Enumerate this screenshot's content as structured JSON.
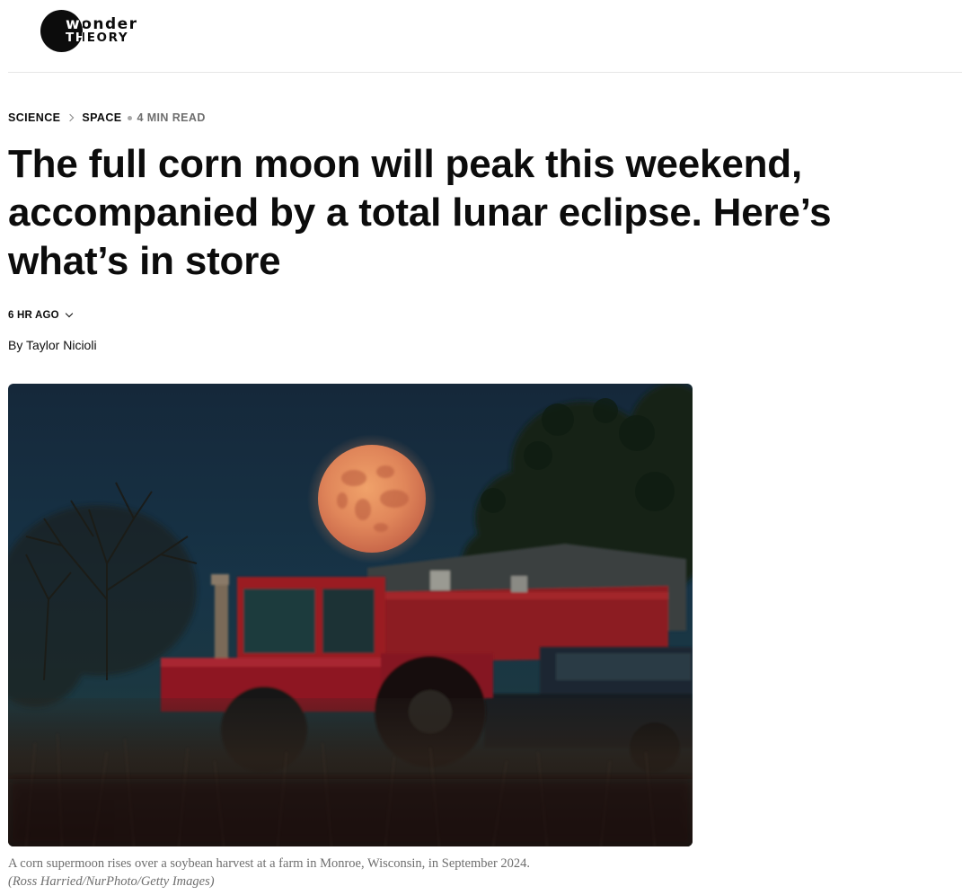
{
  "site": {
    "logo_line1": "wonder",
    "logo_line2": "THEORY"
  },
  "breadcrumb": {
    "section": "SCIENCE",
    "subsection": "SPACE",
    "read_time": "4 MIN READ"
  },
  "article": {
    "headline": "The full corn moon will peak this weekend, accompanied by a total lunar eclipse. Here’s what’s in store",
    "timestamp": "6 HR AGO",
    "byline_prefix": "By ",
    "author": "Taylor Nicioli"
  },
  "image": {
    "caption": "A corn supermoon rises over a soybean harvest at a farm in Monroe, Wisconsin, in September 2024.",
    "credit": "(Ross Harried/NurPhoto/Getty Images)"
  },
  "icons": [
    "chevron-right-icon",
    "dot-icon",
    "chevron-down-icon"
  ]
}
